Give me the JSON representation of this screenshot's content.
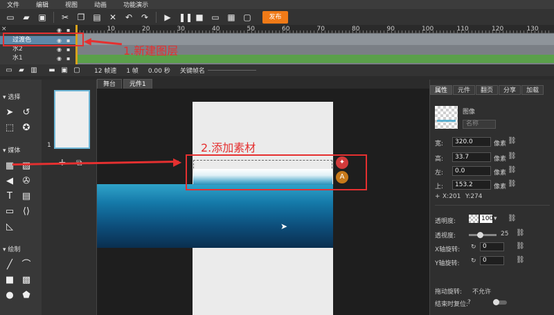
{
  "menu": [
    "文件",
    "编辑",
    "视图",
    "动画",
    "功能演示"
  ],
  "toolbar": {
    "publish_label": "发布"
  },
  "ruler": {
    "marks": [
      "10",
      "20",
      "30",
      "40",
      "50",
      "60",
      "70",
      "80",
      "90",
      "100",
      "110",
      "120",
      "130"
    ]
  },
  "layers": [
    {
      "name": "过渡色",
      "selected": true
    },
    {
      "name": "水2",
      "selected": false
    },
    {
      "name": "水1",
      "selected": false
    }
  ],
  "timeline_status": {
    "fps": "12 帧速",
    "frame": "1 帧",
    "time": "0.00 秒",
    "keyframe_label": "关键帧名"
  },
  "tabs": [
    "舞台",
    "元件1"
  ],
  "left_sections": {
    "select": "选择",
    "media": "媒体",
    "draw": "绘制"
  },
  "thumb": {
    "page_number": "1"
  },
  "annotations": {
    "new_layer": "1.新建图层",
    "add_material": "2.添加素材"
  },
  "right_panel": {
    "tabs": [
      "属性",
      "元件",
      "翻页",
      "分享",
      "加载"
    ],
    "type_label": "图像",
    "name_placeholder": "名称",
    "width_label": "宽:",
    "width": "320.0",
    "height_label": "高:",
    "height": "33.7",
    "left_label": "左:",
    "left": "0.0",
    "top_label": "上:",
    "top": "153.2",
    "unit": "像素",
    "coord_x": "X:201",
    "coord_y": "Y:274",
    "opacity_label": "透明度:",
    "opacity": "100",
    "perspective_label": "透视度:",
    "perspective": "25",
    "rotx_label": "X轴旋转:",
    "rotx": "0",
    "roty_label": "Y轴旋转:",
    "roty": "0",
    "drag_label": "拖动旋转:",
    "drag_value": "不允许",
    "reset_label": "结束时复位:"
  },
  "colors": {
    "accent": "#f07a17",
    "annotation": "#e53030",
    "selected_layer": "#5e88a8"
  }
}
